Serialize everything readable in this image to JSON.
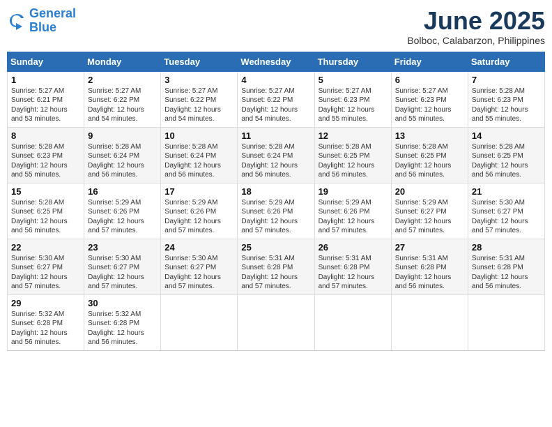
{
  "header": {
    "logo_line1": "General",
    "logo_line2": "Blue",
    "month_title": "June 2025",
    "location": "Bolboc, Calabarzon, Philippines"
  },
  "weekdays": [
    "Sunday",
    "Monday",
    "Tuesday",
    "Wednesday",
    "Thursday",
    "Friday",
    "Saturday"
  ],
  "weeks": [
    [
      {
        "day": "1",
        "sunrise": "5:27 AM",
        "sunset": "6:21 PM",
        "daylight": "12 hours and 53 minutes."
      },
      {
        "day": "2",
        "sunrise": "5:27 AM",
        "sunset": "6:22 PM",
        "daylight": "12 hours and 54 minutes."
      },
      {
        "day": "3",
        "sunrise": "5:27 AM",
        "sunset": "6:22 PM",
        "daylight": "12 hours and 54 minutes."
      },
      {
        "day": "4",
        "sunrise": "5:27 AM",
        "sunset": "6:22 PM",
        "daylight": "12 hours and 54 minutes."
      },
      {
        "day": "5",
        "sunrise": "5:27 AM",
        "sunset": "6:23 PM",
        "daylight": "12 hours and 55 minutes."
      },
      {
        "day": "6",
        "sunrise": "5:27 AM",
        "sunset": "6:23 PM",
        "daylight": "12 hours and 55 minutes."
      },
      {
        "day": "7",
        "sunrise": "5:28 AM",
        "sunset": "6:23 PM",
        "daylight": "12 hours and 55 minutes."
      }
    ],
    [
      {
        "day": "8",
        "sunrise": "5:28 AM",
        "sunset": "6:23 PM",
        "daylight": "12 hours and 55 minutes."
      },
      {
        "day": "9",
        "sunrise": "5:28 AM",
        "sunset": "6:24 PM",
        "daylight": "12 hours and 56 minutes."
      },
      {
        "day": "10",
        "sunrise": "5:28 AM",
        "sunset": "6:24 PM",
        "daylight": "12 hours and 56 minutes."
      },
      {
        "day": "11",
        "sunrise": "5:28 AM",
        "sunset": "6:24 PM",
        "daylight": "12 hours and 56 minutes."
      },
      {
        "day": "12",
        "sunrise": "5:28 AM",
        "sunset": "6:25 PM",
        "daylight": "12 hours and 56 minutes."
      },
      {
        "day": "13",
        "sunrise": "5:28 AM",
        "sunset": "6:25 PM",
        "daylight": "12 hours and 56 minutes."
      },
      {
        "day": "14",
        "sunrise": "5:28 AM",
        "sunset": "6:25 PM",
        "daylight": "12 hours and 56 minutes."
      }
    ],
    [
      {
        "day": "15",
        "sunrise": "5:28 AM",
        "sunset": "6:25 PM",
        "daylight": "12 hours and 56 minutes."
      },
      {
        "day": "16",
        "sunrise": "5:29 AM",
        "sunset": "6:26 PM",
        "daylight": "12 hours and 57 minutes."
      },
      {
        "day": "17",
        "sunrise": "5:29 AM",
        "sunset": "6:26 PM",
        "daylight": "12 hours and 57 minutes."
      },
      {
        "day": "18",
        "sunrise": "5:29 AM",
        "sunset": "6:26 PM",
        "daylight": "12 hours and 57 minutes."
      },
      {
        "day": "19",
        "sunrise": "5:29 AM",
        "sunset": "6:26 PM",
        "daylight": "12 hours and 57 minutes."
      },
      {
        "day": "20",
        "sunrise": "5:29 AM",
        "sunset": "6:27 PM",
        "daylight": "12 hours and 57 minutes."
      },
      {
        "day": "21",
        "sunrise": "5:30 AM",
        "sunset": "6:27 PM",
        "daylight": "12 hours and 57 minutes."
      }
    ],
    [
      {
        "day": "22",
        "sunrise": "5:30 AM",
        "sunset": "6:27 PM",
        "daylight": "12 hours and 57 minutes."
      },
      {
        "day": "23",
        "sunrise": "5:30 AM",
        "sunset": "6:27 PM",
        "daylight": "12 hours and 57 minutes."
      },
      {
        "day": "24",
        "sunrise": "5:30 AM",
        "sunset": "6:27 PM",
        "daylight": "12 hours and 57 minutes."
      },
      {
        "day": "25",
        "sunrise": "5:31 AM",
        "sunset": "6:28 PM",
        "daylight": "12 hours and 57 minutes."
      },
      {
        "day": "26",
        "sunrise": "5:31 AM",
        "sunset": "6:28 PM",
        "daylight": "12 hours and 57 minutes."
      },
      {
        "day": "27",
        "sunrise": "5:31 AM",
        "sunset": "6:28 PM",
        "daylight": "12 hours and 56 minutes."
      },
      {
        "day": "28",
        "sunrise": "5:31 AM",
        "sunset": "6:28 PM",
        "daylight": "12 hours and 56 minutes."
      }
    ],
    [
      {
        "day": "29",
        "sunrise": "5:32 AM",
        "sunset": "6:28 PM",
        "daylight": "12 hours and 56 minutes."
      },
      {
        "day": "30",
        "sunrise": "5:32 AM",
        "sunset": "6:28 PM",
        "daylight": "12 hours and 56 minutes."
      },
      null,
      null,
      null,
      null,
      null
    ]
  ]
}
